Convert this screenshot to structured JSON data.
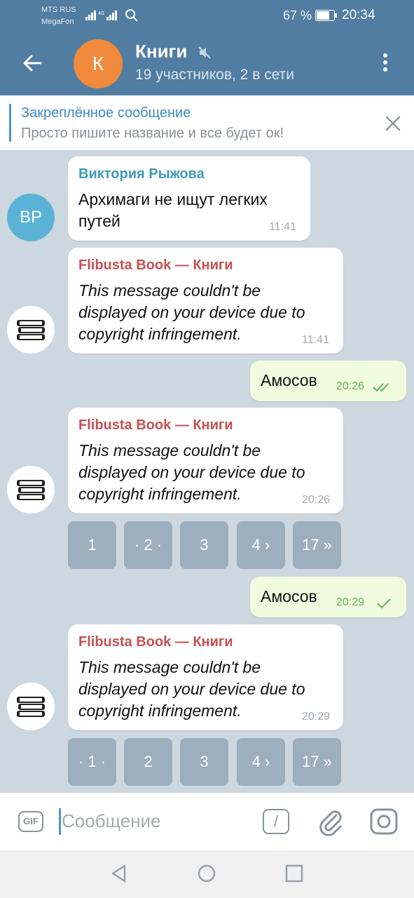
{
  "status_bar": {
    "carrier1": "MTS RUS",
    "carrier2": "MegaFon",
    "battery": "67 %",
    "time": "20:34"
  },
  "header": {
    "avatar_letter": "К",
    "title": "Книги",
    "subtitle": "19 участников, 2 в сети",
    "icons": [
      "back-arrow-icon",
      "mute-icon",
      "more-vert-icon"
    ]
  },
  "pinned": {
    "title": "Закреплённое сообщение",
    "text": "Просто пишите название и все будет ок!"
  },
  "messages": [
    {
      "sender": "Виктория Рыжова",
      "avatar": "ВР",
      "lines": [
        "Архимаги не ищут легких",
        "путей"
      ],
      "time": "11:41"
    },
    {
      "sender": "Flibusta Book — Книги",
      "lines": [
        "This message couldn't be",
        "displayed on your device due to",
        "copyright infringement."
      ],
      "time": "11:41"
    },
    {
      "text": "Амосов",
      "time": "20:26"
    },
    {
      "sender": "Flibusta Book — Книги",
      "lines": [
        "This message couldn't be",
        "displayed on your device due to",
        "copyright infringement."
      ],
      "time": "20:26"
    },
    {
      "text": "Амосов",
      "time": "20:29"
    },
    {
      "sender": "Flibusta Book — Книги",
      "lines": [
        "This message couldn't be",
        "displayed on your device due to",
        "copyright infringement."
      ],
      "time": "20:29"
    }
  ],
  "keyboard1": [
    "1",
    "· 2 ·",
    "3",
    "4 ›",
    "17 »"
  ],
  "keyboard2": [
    "· 1 ·",
    "2",
    "3",
    "4 ›",
    "17 »"
  ],
  "input": {
    "gif_label": "GIF",
    "placeholder": "Сообщение",
    "slash": "/"
  },
  "colors": {
    "header": "#517da2",
    "bot_sender": "#c45153",
    "user_sender": "#3d9bb8",
    "avatar_orange": "#f18a3c",
    "avatar_blue": "#5ab3d6",
    "outgoing_bubble": "#effdde",
    "check_green": "#6aad5c"
  }
}
